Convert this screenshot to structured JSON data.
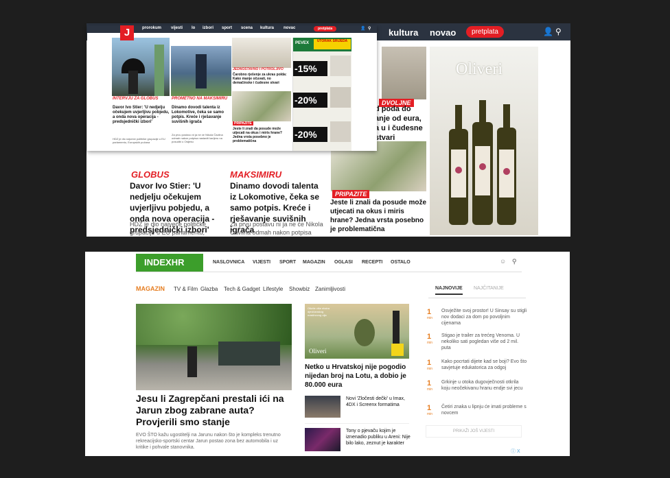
{
  "jutarnji_bg": {
    "nav": {
      "kultura": "kultura",
      "novac": "novao",
      "subscribe": "pretplata"
    },
    "story_left_label": "GLOBUS",
    "story_left_title": "Davor Ivo Stier: 'U nedjelju očekujem uvjerljivu pobjedu, a onda nova operacija - predsjednički izbori'",
    "story_left_desc": "HDZ je dio najveće političke grupacije u EU parlamentu, Europskih pučana, na njegovi zastupnici imaju i najveći",
    "story_mid_label": "MAKSIMIRU",
    "story_mid_title": "Dinamo dovodi talenta iz Lokomotive, čeka se samo potpis. Kreće i rješavanje suvišnih igrača",
    "story_mid_desc": "Za prvu postavu ni ja ne će Nikola Čavlina odmah nakon potpisa nastaviti karijeru na posudbi u Osijeku",
    "story_top_tag": "DVOLJNE",
    "story_top_frag": "d poda do anje od eura, a u i čudesne stvari",
    "story_right_tag": "PRIPAZITE",
    "story_right_title": "Jeste li znali da posude može utjecati na okus i miris hrane? Jedna vrsta posebno je problematična",
    "ad_brand": "Oliveri"
  },
  "jutarnji_overlay": {
    "nav": [
      "prorokum",
      "vijesti",
      "lo",
      "izbori",
      "sport",
      "scena",
      "kultura",
      "novac"
    ],
    "sub_btn": "pretplata",
    "c1_tag": "INTERVJU ZA GLOBUS",
    "c1_title": "Davor Ivo Stier: 'U nedjelju očekujem uvjerljivu pobjedu, a onda nova operacija - predsjednički izbori'",
    "c1_desc": "HDZ je dio najveće političke grupacije u EU parlamentu, Europskih pučana",
    "c2_tag": "PROMETNO NA MAKSIMIRU",
    "c2_title": "Dinamo dovodi talenta iz Lokomotive, čeka se samo potpis. Kreće i rješavanje suvišnih igrača",
    "c2_desc": "Za prvu postavu ni ja ne će Nikola Čavlina odmah nakon potpisa nastaviti karijeru na posudbi u Osijeku",
    "c3_tag": "JEDNOSTAVNO I POTROLJIVO",
    "c3_title": "Čarobno rješenje za ukras polda: Kako manje očuvati, no demačinske i čudesne stvari",
    "c4_tag": "PRIPAZITE",
    "c4_title": "Jeste li znali da posude može utjecati na okus i miris hrane? Jedna vrsta posebno je problematična",
    "promo_brand": "PEVEX",
    "promo_badge": "UTORAK SRIJEDA",
    "discounts": [
      "-15%",
      "-20%",
      "-20%"
    ]
  },
  "index": {
    "logo": "INDEXHR",
    "nav": [
      "NASLOVNICA",
      "VIJESTI",
      "SPORT",
      "MAGAZIN",
      "OGLASI",
      "RECEPTI",
      "OSTALO"
    ],
    "section": "MAGAZIN",
    "cats": [
      "TV & Film",
      "Glazba",
      "Tech & Gadget",
      "Lifestyle",
      "Showbiz",
      "Zanimljivosti"
    ],
    "tabs": {
      "latest": "NAJNOVIJE",
      "read": "NAJČITANIJE"
    },
    "main_title": "Jesu li Zagrepčani prestali ići na Jarun zbog zabrane auta? Provjerili smo stanje",
    "main_desc": "EVO ŠTO kažu ugostitelji na Jarunu nakon što je kompleks trenutno rekreacijsko-sportski centar Jarun postao zona bez automobila i uz kritike i pohvale stanovnika.",
    "mid_title": "Netko u Hrvatskoj nije pogodio nijedan broj na Lotu, a dobio je 80.000 eura",
    "mid_ad_text": "Otkrite više ekstra djevičanskog maslinovog ulja",
    "mid_ad_brand": "Oliveri",
    "small1": "Novi 'Zločesti dečki' u Imax, 4DX i Screenx formatima",
    "small2": "Tony o pjevaču kojim je iznenadio publiku u Areni: Nije bilo lako, zeznut je karakter",
    "list": [
      {
        "rank": "1",
        "unit": "min",
        "text": "Osvježite svoj prostor! U Sinsay su stigli nov dodaci za dom po povoljnim cijenama"
      },
      {
        "rank": "1",
        "unit": "min",
        "text": "Stigao je trailer za trećeg Venoma. U nekoliko sati pogledan više od 2 mil. puta"
      },
      {
        "rank": "1",
        "unit": "min",
        "text": "Kako pocrtati dijete kad se boji? Evo što savjetuje edukatorica za odgoj"
      },
      {
        "rank": "1",
        "unit": "min",
        "text": "Grkinje u otoka dugovječnosti otkrila koju neočekivanu hranu endje svi jecu"
      },
      {
        "rank": "1",
        "unit": "min",
        "text": "Četiri znaka u lipnju će imati probleme s novcem"
      }
    ],
    "more_btn": "PRIKAŽI JOŠ VIJESTI",
    "adx": "ⓘ X"
  }
}
